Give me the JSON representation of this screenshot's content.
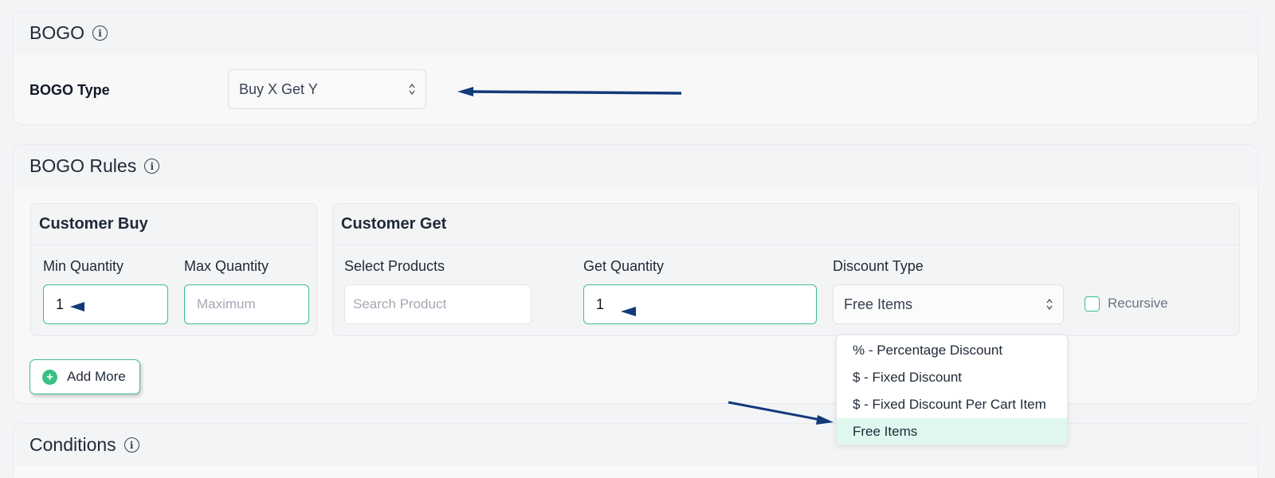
{
  "bogo_section": {
    "title": "BOGO",
    "type_label": "BOGO Type",
    "type_value": "Buy X Get Y"
  },
  "rules_section": {
    "title": "BOGO Rules",
    "customer_buy": {
      "title": "Customer Buy",
      "min_label": "Min Quantity",
      "min_value": "1",
      "max_label": "Max Quantity",
      "max_placeholder": "Maximum"
    },
    "customer_get": {
      "title": "Customer Get",
      "products_label": "Select Products",
      "products_placeholder": "Search Product",
      "quantity_label": "Get Quantity",
      "quantity_value": "1",
      "discount_label": "Discount Type",
      "discount_value": "Free Items",
      "recursive_label": "Recursive"
    },
    "add_more_label": "Add More"
  },
  "conditions_section": {
    "title": "Conditions"
  },
  "discount_options": [
    "% - Percentage Discount",
    "$ - Fixed Discount",
    "$ - Fixed Discount Per Cart Item",
    "Free Items"
  ],
  "colors": {
    "accent_green": "#3bbf85",
    "annotation_arrow": "#123a7a",
    "selected_option_bg": "#dff7ee"
  },
  "icons": [
    "info-icon",
    "updown-chevron-icon",
    "plus-circle-icon",
    "annotation-arrow"
  ]
}
